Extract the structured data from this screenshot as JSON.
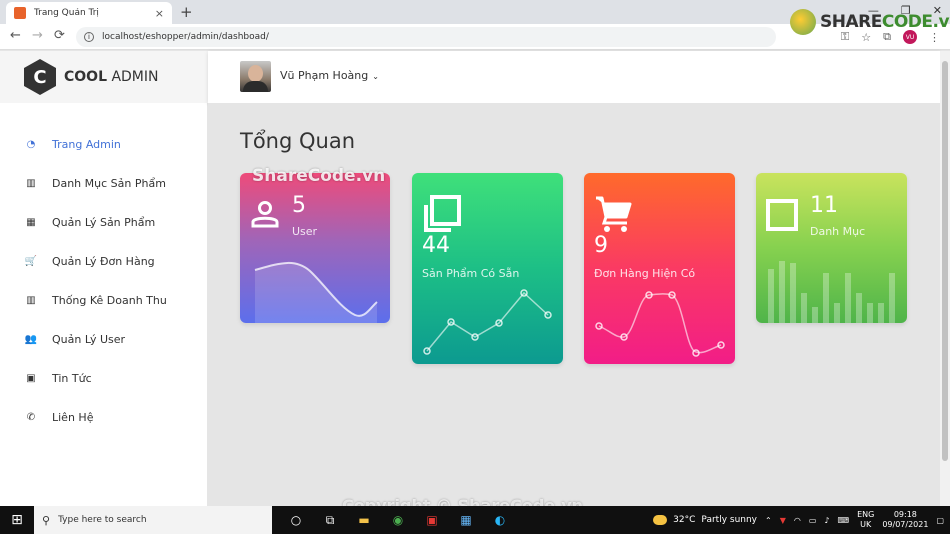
{
  "browser": {
    "tab_title": "Trang Quản Trị",
    "tab_close": "×",
    "new_tab": "+",
    "url": "localhost/eshopper/admin/dashboad/",
    "back": "←",
    "forward": "→",
    "reload": "⟳",
    "window_controls": [
      "—",
      "❐",
      "✕"
    ],
    "profile_initials": "VU"
  },
  "watermark": {
    "logo_text_a": "SHARE",
    "logo_text_b": "CODE.vn",
    "overlay": "ShareCode.vn",
    "footer": "Copyright © ShareCode.vn"
  },
  "sidebar": {
    "logo_letter": "C",
    "logo_bold": "COOL",
    "logo_rest": "ADMIN",
    "items": [
      {
        "label": "Trang Admin",
        "icon": "◔"
      },
      {
        "label": "Danh Mục Sản Phẩm",
        "icon": "▥"
      },
      {
        "label": "Quản Lý Sản Phẩm",
        "icon": "▦"
      },
      {
        "label": "Quản Lý Đơn Hàng",
        "icon": "🛒"
      },
      {
        "label": "Thống Kê Doanh Thu",
        "icon": "▥"
      },
      {
        "label": "Quản Lý User",
        "icon": "👥"
      },
      {
        "label": "Tin Tức",
        "icon": "▣"
      },
      {
        "label": "Liên Hệ",
        "icon": "✆"
      }
    ]
  },
  "header": {
    "user_name": "Vũ Phạm Hoàng",
    "caret": "⌄"
  },
  "main": {
    "title": "Tổng Quan",
    "cards": [
      {
        "value": "5",
        "label": "User"
      },
      {
        "value": "44",
        "label": "Sản Phẩm Có Sẵn"
      },
      {
        "value": "9",
        "label": "Đơn Hàng Hiện Có"
      },
      {
        "value": "11",
        "label": "Danh Mục"
      }
    ]
  },
  "taskbar": {
    "search_placeholder": "Type here to search",
    "weather_temp": "32°C",
    "weather_text": "Partly sunny",
    "lang_top": "ENG",
    "lang_bottom": "UK",
    "time": "09:18",
    "date": "09/07/2021"
  }
}
